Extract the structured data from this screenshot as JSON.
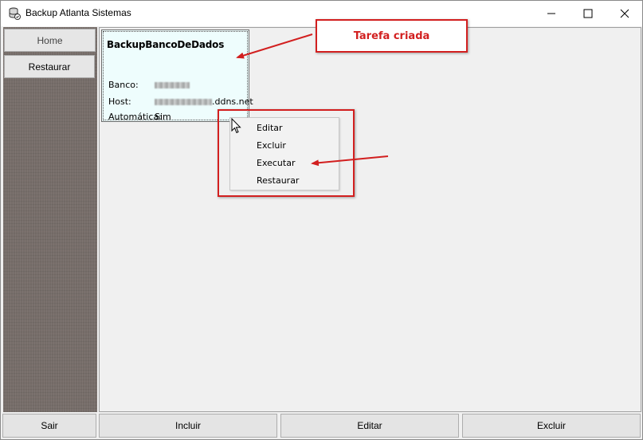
{
  "window": {
    "title": "Backup Atlanta Sistemas"
  },
  "sidebar": {
    "items": [
      {
        "label": "Home"
      },
      {
        "label": "Restaurar"
      }
    ]
  },
  "task_card": {
    "title": "BackupBancoDeDados",
    "banco_label": "Banco:",
    "host_label": "Host:",
    "host_suffix": ".ddns.net",
    "auto_label": "Automática:",
    "auto_value": "Sim"
  },
  "context_menu": {
    "items": [
      "Editar",
      "Excluir",
      "Executar",
      "Restaurar"
    ]
  },
  "annotation": {
    "callout_text": "Tarefa criada",
    "color": "#d21f1f"
  },
  "bottom_bar": {
    "sair": "Sair",
    "incluir": "Incluir",
    "editar": "Editar",
    "excluir": "Excluir"
  },
  "icons": {
    "app": "database-backup-icon",
    "minimize": "minimize-icon",
    "maximize": "maximize-icon",
    "close": "close-icon"
  }
}
